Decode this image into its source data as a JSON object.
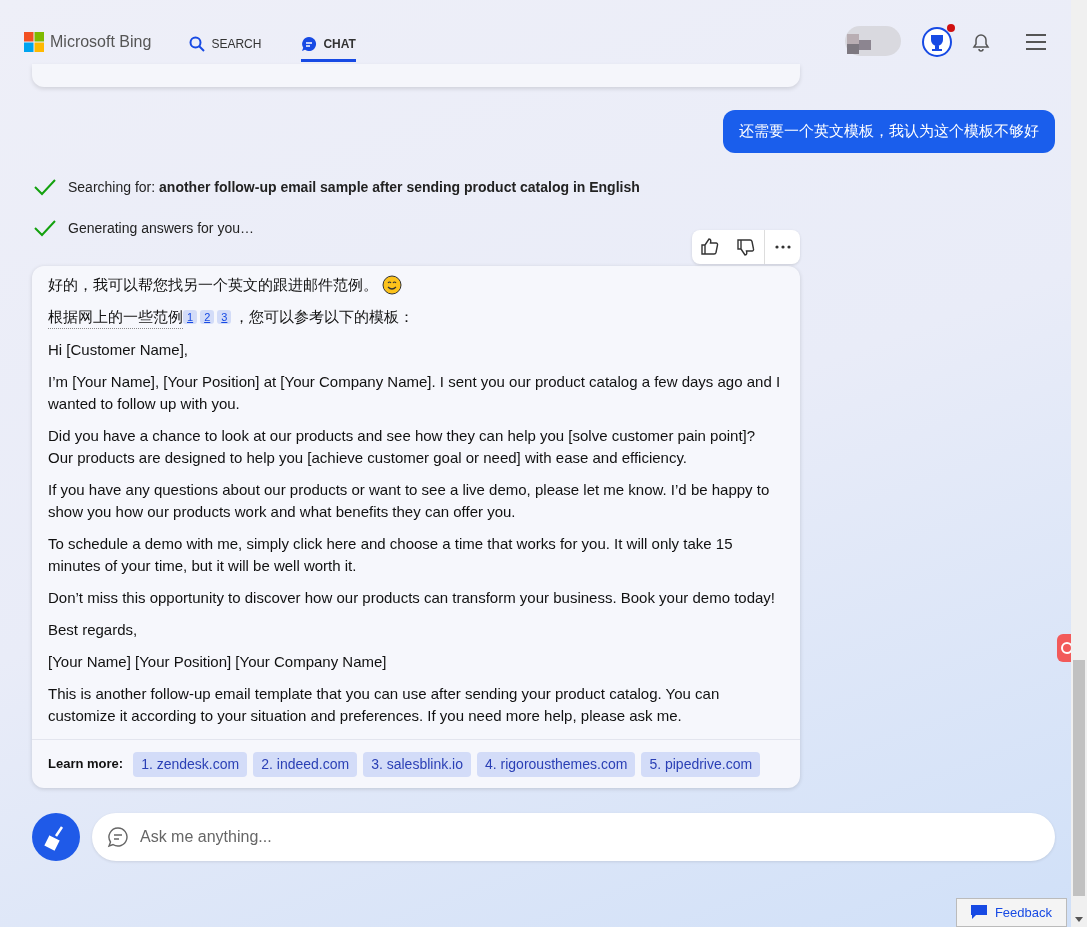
{
  "header": {
    "logo": "Microsoft Bing",
    "tabs": [
      {
        "label": "SEARCH",
        "kind": "search",
        "selected": false
      },
      {
        "label": "CHAT",
        "kind": "chat",
        "selected": true
      }
    ],
    "reward_alert": true
  },
  "user_message": "还需要一个英文模板，我认为这个模板不够好",
  "steps": [
    {
      "text": "Searching for: **another follow-up email sample after sending product catalog in English**",
      "done": true
    },
    {
      "text": "Generating answers for you…",
      "done": true
    }
  ],
  "answer": {
    "paragraphs": [
      {
        "kind": "plain",
        "text": "好的，我可以帮您找另一个英文的跟进邮件范例。",
        "emoji": true
      },
      {
        "kind": "cited",
        "before": "根据网上的一些范例",
        "citations": [
          "1",
          "2",
          "3"
        ],
        "after": "，您可以参考以下的模板："
      },
      {
        "kind": "plain",
        "text": "Hi [Customer Name],"
      },
      {
        "kind": "plain",
        "text": "I’m [Your Name], [Your Position] at [Your Company Name]. I sent you our product catalog a few days ago and I wanted to follow up with you."
      },
      {
        "kind": "plain",
        "text": "Did you have a chance to look at our products and see how they can help you [solve customer pain point]? Our products are designed to help you [achieve customer goal or need] with ease and efficiency."
      },
      {
        "kind": "plain",
        "text": "If you have any questions about our products or want to see a live demo, please let me know. I’d be happy to show you how our products work and what benefits they can offer you."
      },
      {
        "kind": "plain",
        "text": "To schedule a demo with me, simply click here and choose a time that works for you. It will only take 15 minutes of your time, but it will be well worth it."
      },
      {
        "kind": "plain",
        "text": "Don’t miss this opportunity to discover how our products can transform your business. Book your demo today!"
      },
      {
        "kind": "plain",
        "text": "Best regards,"
      },
      {
        "kind": "plain",
        "text": "[Your Name] [Your Position] [Your Company Name]"
      },
      {
        "kind": "plain",
        "text": "This is another follow-up email template that you can use after sending your product catalog. You can customize it according to your situation and preferences. If you need more help, please ask me."
      }
    ],
    "learn_more": {
      "label": "Learn more:",
      "links": [
        "1. zendesk.com",
        "2. indeed.com",
        "3. salesblink.io",
        "4. rigorousthemes.com",
        "5. pipedrive.com"
      ]
    }
  },
  "input": {
    "placeholder": "Ask me anything..."
  },
  "feedback": "Feedback"
}
